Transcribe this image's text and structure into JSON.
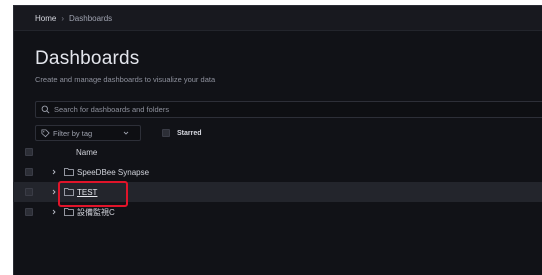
{
  "breadcrumb": {
    "home": "Home",
    "separator": "›",
    "current": "Dashboards"
  },
  "page": {
    "title": "Dashboards",
    "subtitle": "Create and manage dashboards to visualize your data"
  },
  "search": {
    "placeholder": "Search for dashboards and folders",
    "value": ""
  },
  "filters": {
    "tag_label": "Filter by tag",
    "starred_label": "Starred"
  },
  "table": {
    "name_header": "Name",
    "rows": [
      {
        "label": "SpeeDBee Synapse",
        "type": "folder"
      },
      {
        "label": "TEST",
        "type": "folder",
        "highlighted": true
      },
      {
        "label": "設備監視C",
        "type": "folder"
      }
    ]
  },
  "colors": {
    "background": "#111217",
    "highlight_box": "#e0142a",
    "text_primary": "#e3e5ec",
    "text_muted": "#8e919d"
  },
  "icons": {
    "search": "search-icon",
    "tag": "tag-icon",
    "chevron": "chevron-down-icon",
    "expand": "chevron-right-icon",
    "folder": "folder-icon"
  }
}
